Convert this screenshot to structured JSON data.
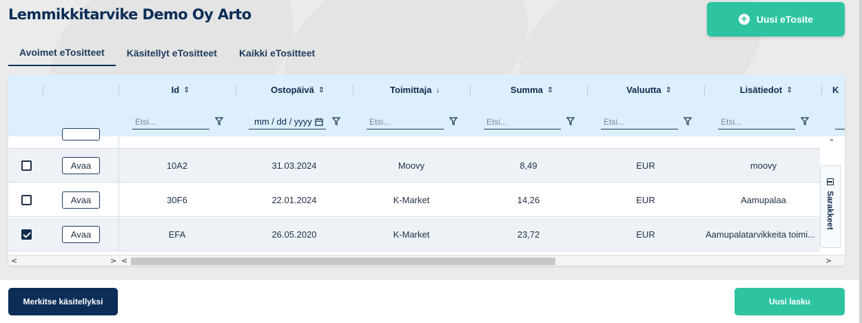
{
  "header": {
    "title": "Lemmikkitarvike Demo Oy Arto",
    "new_etosite_label": "Uusi eTosite"
  },
  "tabs": [
    {
      "label": "Avoimet eTositteet",
      "active": true
    },
    {
      "label": "Käsitellyt eTositteet",
      "active": false
    },
    {
      "label": "Kaikki eTositteet",
      "active": false
    }
  ],
  "grid": {
    "columns": [
      {
        "label": "Id",
        "sort": "⌃⌄"
      },
      {
        "label": "Ostopäivä",
        "sort": "⌃⌄"
      },
      {
        "label": "Toimittaja",
        "sort": "↓"
      },
      {
        "label": "Summa",
        "sort": "⌃⌄"
      },
      {
        "label": "Valuutta",
        "sort": "⌃⌄"
      },
      {
        "label": "Lisätiedot",
        "sort": "⌃⌄"
      },
      {
        "label": "K",
        "sort": ""
      }
    ],
    "filter_placeholder": "Etsi...",
    "date_placeholder": "mm / dd / yyyy",
    "open_label": "Avaa",
    "rows": [
      {
        "checked": false,
        "id": "10A2",
        "date": "31.03.2024",
        "supplier": "Moovy",
        "sum": "8,49",
        "currency": "EUR",
        "info": "moovy"
      },
      {
        "checked": false,
        "id": "30F6",
        "date": "22.01.2024",
        "supplier": "K-Market",
        "sum": "14,26",
        "currency": "EUR",
        "info": "Aamupalaa"
      },
      {
        "checked": true,
        "id": "EFA",
        "date": "26.05.2020",
        "supplier": "K-Market",
        "sum": "23,72",
        "currency": "EUR",
        "info": "Aamupalatarvikkeita toimi..."
      }
    ],
    "columns_panel_label": "Sarakkeet"
  },
  "footer": {
    "mark_processed_label": "Merkitse käsitellyksi",
    "new_invoice_label": "Uusi lasku"
  },
  "colors": {
    "primary": "#0b2d57",
    "accent": "#2ec4a1",
    "header_bg": "#ddeefc"
  }
}
